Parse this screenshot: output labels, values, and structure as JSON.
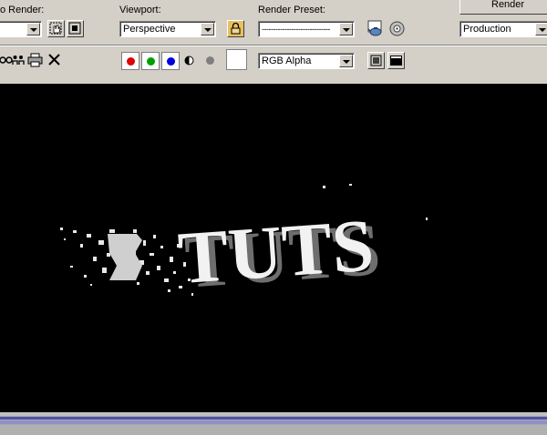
{
  "toolbar_top": {
    "area_to_render_label": "o Render:",
    "area_to_render_value": "",
    "viewport_label": "Viewport:",
    "viewport_value": "Perspective",
    "render_preset_label": "Render Preset:",
    "render_preset_value": "------------------------------",
    "render_button_label": "Render",
    "render_mode_value": "Production"
  },
  "toolbar_second": {
    "channel_value": "RGB Alpha",
    "channel_swatches": {
      "red": "#e00000",
      "green": "#00a000",
      "blue": "#0000e0",
      "mono": "#7f7f7f"
    }
  },
  "render_output": {
    "text": "TUTS",
    "background": "#000000"
  },
  "timeline": {
    "bar_color": "#6f6fbd"
  }
}
